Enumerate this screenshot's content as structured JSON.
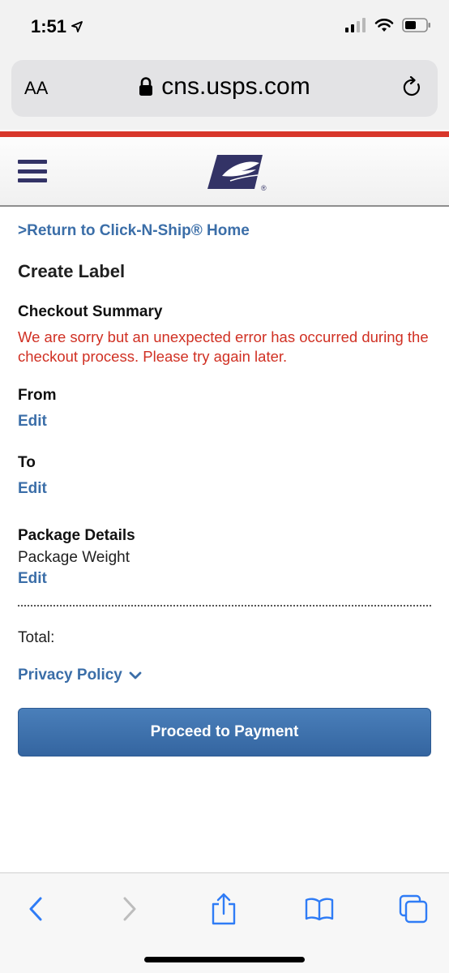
{
  "status_bar": {
    "time": "1:51"
  },
  "browser": {
    "text_size_button": "AA",
    "url": "cns.usps.com"
  },
  "page": {
    "return_link": ">Return to Click-N-Ship® Home",
    "title": "Create Label",
    "checkout_summary": {
      "heading": "Checkout Summary",
      "error": "We are sorry but an unexpected error has occurred during the checkout process. Please try again later."
    },
    "from": {
      "heading": "From",
      "edit": "Edit"
    },
    "to": {
      "heading": "To",
      "edit": "Edit"
    },
    "package_details": {
      "heading": "Package Details",
      "weight_label": "Package Weight",
      "edit": "Edit"
    },
    "total_label": "Total:",
    "privacy_policy": "Privacy Policy",
    "proceed_button": "Proceed to Payment"
  },
  "icons": {
    "location": "location-arrow-icon",
    "signal": "cellular-signal-icon",
    "wifi": "wifi-icon",
    "battery": "battery-icon",
    "lock": "lock-icon",
    "reload": "reload-icon",
    "menu": "hamburger-menu-icon",
    "logo": "usps-eagle-logo",
    "chevron": "chevron-down-icon",
    "back": "back-arrow-icon",
    "forward": "forward-arrow-icon",
    "share": "share-icon",
    "bookmarks": "bookmarks-icon",
    "tabs": "tabs-icon"
  },
  "colors": {
    "link": "#3b6ea8",
    "error": "#d03023",
    "button": "#3b6ea8",
    "accent_stripe": "#d8362a",
    "brand_navy": "#333366"
  }
}
